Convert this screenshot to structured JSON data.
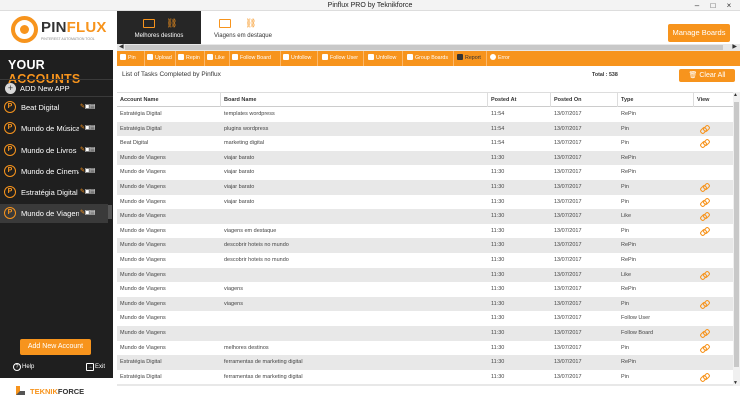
{
  "window": {
    "title": "Pinflux PRO by Teknikforce"
  },
  "logo": {
    "name_a": "PIN",
    "name_b": "FLUX",
    "tagline": "PINTEREST AUTOMATION TOOL"
  },
  "boards": [
    {
      "label": "Melhores destinos",
      "active": true
    },
    {
      "label": "Viagens em destaque",
      "active": false
    }
  ],
  "header": {
    "manage_boards": "Manage Boards"
  },
  "sidebar": {
    "title_a": "YOUR",
    "title_b": "ACCOUNTS",
    "add_app": "ADD New APP",
    "accounts": [
      {
        "name": "Beat Digital"
      },
      {
        "name": "Mundo de Música"
      },
      {
        "name": "Mundo de Livros"
      },
      {
        "name": "Mundo de Cinema"
      },
      {
        "name": "Estratégia Digital"
      },
      {
        "name": "Mundo de Viagens"
      }
    ],
    "add_account": "Add New Account",
    "help": "Help",
    "exit": "Exit"
  },
  "brand": {
    "a": "TEKNIK",
    "b": "FORCE"
  },
  "toolbar": [
    "Pin",
    "Upload",
    "Repin",
    "Like",
    "Follow Board",
    "Unfollow",
    "Follow User",
    "Unfollow",
    "Group Boards",
    "Report",
    "Error"
  ],
  "tasks": {
    "title": "List of Tasks Completed by Pinflux",
    "total": "Total : 538",
    "clear_all": "Clear All",
    "columns": [
      "Account Name",
      "Board Name",
      "Posted At",
      "Posted On",
      "Type",
      "View"
    ],
    "rows": [
      {
        "account": "Estratégia Digital",
        "board": "templates wordpress",
        "at": "11:54",
        "on": "13/07/2017",
        "type": "RePin",
        "view": false
      },
      {
        "account": "Estratégia Digital",
        "board": "plugins wordpress",
        "at": "11:54",
        "on": "13/07/2017",
        "type": "Pin",
        "view": true
      },
      {
        "account": "Beat Digital",
        "board": "marketing digital",
        "at": "11:54",
        "on": "13/07/2017",
        "type": "Pin",
        "view": true
      },
      {
        "account": "Mundo de Viagens",
        "board": "viajar barato",
        "at": "11:30",
        "on": "13/07/2017",
        "type": "RePin",
        "view": false
      },
      {
        "account": "Mundo de Viagens",
        "board": "viajar barato",
        "at": "11:30",
        "on": "13/07/2017",
        "type": "RePin",
        "view": false
      },
      {
        "account": "Mundo de Viagens",
        "board": "viajar barato",
        "at": "11:30",
        "on": "13/07/2017",
        "type": "Pin",
        "view": true
      },
      {
        "account": "Mundo de Viagens",
        "board": "viajar barato",
        "at": "11:30",
        "on": "13/07/2017",
        "type": "Pin",
        "view": true
      },
      {
        "account": "Mundo de Viagens",
        "board": "",
        "at": "11:30",
        "on": "13/07/2017",
        "type": "Like",
        "view": true
      },
      {
        "account": "Mundo de Viagens",
        "board": "viagens em destaque",
        "at": "11:30",
        "on": "13/07/2017",
        "type": "Pin",
        "view": true
      },
      {
        "account": "Mundo de Viagens",
        "board": "descobrir hoteis no mundo",
        "at": "11:30",
        "on": "13/07/2017",
        "type": "RePin",
        "view": false
      },
      {
        "account": "Mundo de Viagens",
        "board": "descobrir hoteis no mundo",
        "at": "11:30",
        "on": "13/07/2017",
        "type": "RePin",
        "view": false
      },
      {
        "account": "Mundo de Viagens",
        "board": "",
        "at": "11:30",
        "on": "13/07/2017",
        "type": "Like",
        "view": true
      },
      {
        "account": "Mundo de Viagens",
        "board": "viagens",
        "at": "11:30",
        "on": "13/07/2017",
        "type": "RePin",
        "view": false
      },
      {
        "account": "Mundo de Viagens",
        "board": "viagens",
        "at": "11:30",
        "on": "13/07/2017",
        "type": "Pin",
        "view": true
      },
      {
        "account": "Mundo de Viagens",
        "board": "",
        "at": "11:30",
        "on": "13/07/2017",
        "type": "Follow User",
        "view": false
      },
      {
        "account": "Mundo de Viagens",
        "board": "",
        "at": "11:30",
        "on": "13/07/2017",
        "type": "Follow Board",
        "view": true
      },
      {
        "account": "Mundo de Viagens",
        "board": "melhores destinos",
        "at": "11:30",
        "on": "13/07/2017",
        "type": "Pin",
        "view": true
      },
      {
        "account": "Estratégia Digital",
        "board": "ferramentas de marketing digital",
        "at": "11:30",
        "on": "13/07/2017",
        "type": "RePin",
        "view": false
      },
      {
        "account": "Estratégia Digital",
        "board": "ferramentas de marketing digital",
        "at": "11:30",
        "on": "13/07/2017",
        "type": "Pin",
        "view": true
      },
      {
        "account": "",
        "board": "",
        "at": "",
        "on": "",
        "type": "",
        "view": false
      }
    ]
  },
  "colors": {
    "accent": "#f7941d",
    "sidebar": "#1f1f1f",
    "row_alt": "#e8e8e8"
  }
}
